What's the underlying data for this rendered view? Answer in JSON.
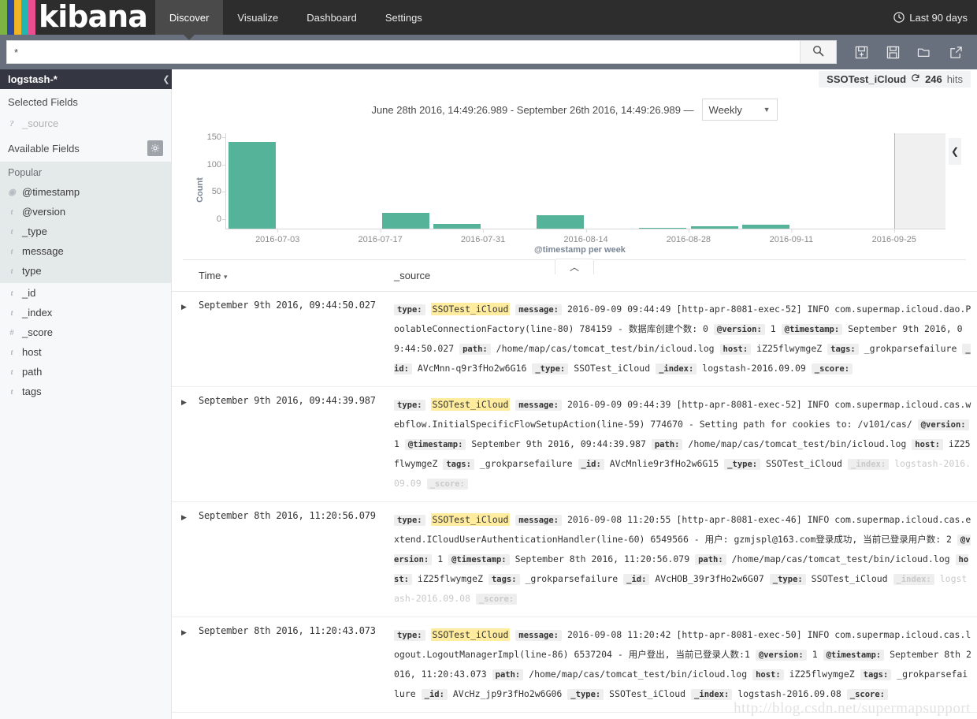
{
  "app": {
    "brand": "kibana",
    "logo_colors": [
      "#7cb342",
      "#2e4a9e",
      "#f2b423",
      "#23b6b0",
      "#ec4d8e"
    ],
    "accent_bar": "#54b399"
  },
  "nav": {
    "tabs": [
      {
        "label": "Discover",
        "active": true
      },
      {
        "label": "Visualize",
        "active": false
      },
      {
        "label": "Dashboard",
        "active": false
      },
      {
        "label": "Settings",
        "active": false
      }
    ],
    "time_picker": {
      "icon": "clock-icon",
      "label": "Last 90 days"
    }
  },
  "search": {
    "value": "*",
    "placeholder": "",
    "submit_icon": "search-icon",
    "actions": [
      {
        "name": "new-search-icon",
        "label": "New"
      },
      {
        "name": "save-search-icon",
        "label": "Save"
      },
      {
        "name": "open-search-icon",
        "label": "Open"
      },
      {
        "name": "share-search-icon",
        "label": "Share"
      }
    ]
  },
  "sidebar": {
    "index_pattern": "logstash-*",
    "collapse_icon": "chevron-left-icon",
    "selected_fields_label": "Selected Fields",
    "selected_fields": [
      {
        "name": "_source",
        "type_icon": "?"
      }
    ],
    "available_fields_label": "Available Fields",
    "settings_icon": "gear-icon",
    "popular_label": "Popular",
    "popular_fields": [
      {
        "name": "@timestamp",
        "type_icon": "clock"
      },
      {
        "name": "@version",
        "type_icon": "t"
      },
      {
        "name": "_type",
        "type_icon": "t"
      },
      {
        "name": "message",
        "type_icon": "t"
      },
      {
        "name": "type",
        "type_icon": "t"
      }
    ],
    "available_fields": [
      {
        "name": "_id",
        "type_icon": "t"
      },
      {
        "name": "_index",
        "type_icon": "t"
      },
      {
        "name": "_score",
        "type_icon": "#"
      },
      {
        "name": "host",
        "type_icon": "t"
      },
      {
        "name": "path",
        "type_icon": "t"
      },
      {
        "name": "tags",
        "type_icon": "t"
      }
    ]
  },
  "hits": {
    "index_label": "SSOTest_iCloud",
    "refresh_icon": "refresh-icon",
    "count": "246",
    "unit": "hits"
  },
  "chart_header": {
    "range": "June 28th 2016, 14:49:26.989 - September 26th 2016, 14:49:26.989 —",
    "interval_value": "Weekly",
    "interval_caret": "caret-down-icon",
    "collapse_icon": "chevron-left-icon",
    "toggle_icon": "chevron-up-icon"
  },
  "chart_data": {
    "type": "bar",
    "title": "",
    "xlabel": "@timestamp per week",
    "ylabel": "Count",
    "ylim": [
      0,
      175
    ],
    "yticks": [
      0,
      50,
      100,
      150
    ],
    "grid": false,
    "legend": "none",
    "xtick_labels": [
      "2016-07-03",
      "2016-07-17",
      "2016-07-31",
      "2016-08-14",
      "2016-08-28",
      "2016-09-11",
      "2016-09-25"
    ],
    "categories": [
      "2016-06-26",
      "2016-07-03",
      "2016-07-10",
      "2016-07-17",
      "2016-07-24",
      "2016-07-31",
      "2016-08-07",
      "2016-08-14",
      "2016-08-21",
      "2016-08-28",
      "2016-09-04",
      "2016-09-11",
      "2016-09-18",
      "2016-09-25"
    ],
    "values": [
      159,
      0,
      0,
      29,
      9,
      0,
      25,
      0,
      1,
      5,
      7,
      0,
      0,
      0
    ],
    "now_marker": "2016-09-26",
    "bar_color": "#54b399",
    "now_line_color": "#e2a97e"
  },
  "table": {
    "columns": [
      {
        "label": "Time",
        "sort_icon": "caret-down-icon"
      },
      {
        "label": "_source"
      }
    ],
    "rows": [
      {
        "expand_icon": "caret-right-icon",
        "time": "September 9th 2016, 09:44:50.027",
        "fields": [
          {
            "key": "type:",
            "value": "SSOTest_iCloud",
            "highlight": true
          },
          {
            "key": "message:",
            "value": "2016-09-09 09:44:49 [http-apr-8081-exec-52] INFO com.supermap.icloud.dao.PoolableConnectionFactory(line-80) 784159 - 数据库创建个数: 0"
          },
          {
            "key": "@version:",
            "value": "1"
          },
          {
            "key": "@timestamp:",
            "value": "September 9th 2016, 09:44:50.027"
          },
          {
            "key": "path:",
            "value": "/home/map/cas/tomcat_test/bin/icloud.log"
          },
          {
            "key": "host:",
            "value": "iZ25flwymgeZ"
          },
          {
            "key": "tags:",
            "value": "_grokparsefailure"
          },
          {
            "key": "_id:",
            "value": "AVcMnn-q9r3fHo2w6G16"
          },
          {
            "key": "_type:",
            "value": "SSOTest_iCloud"
          },
          {
            "key": "_index:",
            "value": "logstash-2016.09.09"
          },
          {
            "key": "_score:",
            "value": ""
          }
        ]
      },
      {
        "expand_icon": "caret-right-icon",
        "time": "September 9th 2016, 09:44:39.987",
        "fields": [
          {
            "key": "type:",
            "value": "SSOTest_iCloud",
            "highlight": true
          },
          {
            "key": "message:",
            "value": "2016-09-09 09:44:39 [http-apr-8081-exec-52] INFO com.supermap.icloud.cas.webflow.InitialSpecificFlowSetupAction(line-59) 774670 - Setting path for cookies to: /v101/cas/"
          },
          {
            "key": "@version:",
            "value": "1"
          },
          {
            "key": "@timestamp:",
            "value": "September 9th 2016, 09:44:39.987"
          },
          {
            "key": "path:",
            "value": "/home/map/cas/tomcat_test/bin/icloud.log"
          },
          {
            "key": "host:",
            "value": "iZ25flwymgeZ"
          },
          {
            "key": "tags:",
            "value": "_grokparsefailure"
          },
          {
            "key": "_id:",
            "value": "AVcMnlie9r3fHo2w6G15"
          },
          {
            "key": "_type:",
            "value": "SSOTest_iCloud"
          },
          {
            "key": "_index:",
            "value": "logstash-2016.09.09",
            "faded": true
          },
          {
            "key": "_score:",
            "value": "",
            "faded": true
          }
        ]
      },
      {
        "expand_icon": "caret-right-icon",
        "time": "September 8th 2016, 11:20:56.079",
        "fields": [
          {
            "key": "type:",
            "value": "SSOTest_iCloud",
            "highlight": true
          },
          {
            "key": "message:",
            "value": "2016-09-08 11:20:55 [http-apr-8081-exec-46] INFO com.supermap.icloud.cas.extend.ICloudUserAuthenticationHandler(line-60) 6549566 - 用户: gzmjspl@163.com登录成功, 当前已登录用户数: 2"
          },
          {
            "key": "@version:",
            "value": "1"
          },
          {
            "key": "@timestamp:",
            "value": "September 8th 2016, 11:20:56.079"
          },
          {
            "key": "path:",
            "value": "/home/map/cas/tomcat_test/bin/icloud.log"
          },
          {
            "key": "host:",
            "value": "iZ25flwymgeZ"
          },
          {
            "key": "tags:",
            "value": "_grokparsefailure"
          },
          {
            "key": "_id:",
            "value": "AVcHOB_39r3fHo2w6G07"
          },
          {
            "key": "_type:",
            "value": "SSOTest_iCloud"
          },
          {
            "key": "_index:",
            "value": "logstash-2016.09.08",
            "faded": true
          },
          {
            "key": "_score:",
            "value": "",
            "faded": true
          }
        ]
      },
      {
        "expand_icon": "caret-right-icon",
        "time": "September 8th 2016, 11:20:43.073",
        "fields": [
          {
            "key": "type:",
            "value": "SSOTest_iCloud",
            "highlight": true
          },
          {
            "key": "message:",
            "value": "2016-09-08 11:20:42 [http-apr-8081-exec-50] INFO com.supermap.icloud.cas.logout.LogoutManagerImpl(line-86) 6537204 - 用户登出, 当前已登录人数:1"
          },
          {
            "key": "@version:",
            "value": "1"
          },
          {
            "key": "@timestamp:",
            "value": "September 8th 2016, 11:20:43.073"
          },
          {
            "key": "path:",
            "value": "/home/map/cas/tomcat_test/bin/icloud.log"
          },
          {
            "key": "host:",
            "value": "iZ25flwymgeZ"
          },
          {
            "key": "tags:",
            "value": "_grokparsefailure"
          },
          {
            "key": "_id:",
            "value": "AVcHz_jp9r3fHo2w6G06"
          },
          {
            "key": "_type:",
            "value": "SSOTest_iCloud"
          },
          {
            "key": "_index:",
            "value": "logstash-2016.09.08"
          },
          {
            "key": "_score:",
            "value": ""
          }
        ]
      }
    ]
  },
  "watermark": "http://blog.csdn.net/supermapsupport"
}
